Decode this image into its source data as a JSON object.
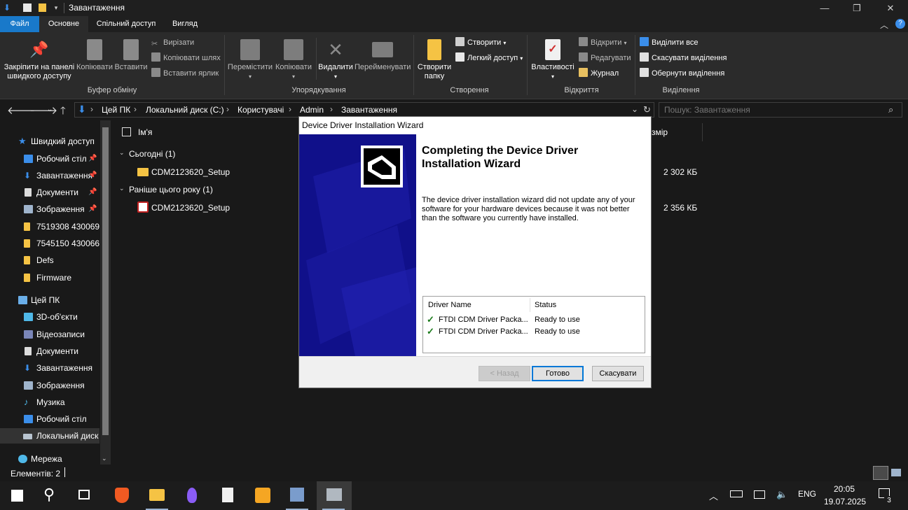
{
  "window": {
    "title": "Завантаження"
  },
  "ribbon_tabs": [
    "Файл",
    "Основне",
    "Спільний доступ",
    "Вигляд"
  ],
  "ribbon": {
    "clipboard": {
      "pin_label_1": "Закріпити на панелі",
      "pin_label_2": "швидкого доступу",
      "copy": "Копіювати",
      "paste": "Вставити",
      "cut": "Вирізати",
      "copy_path": "Копіювати шлях",
      "paste_shortcut": "Вставити ярлик",
      "group_label": "Буфер обміну"
    },
    "organize": {
      "move_to": "Перемістити",
      "copy_to": "Копіювати",
      "delete": "Видалити",
      "rename": "Перейменувати",
      "group_label": "Упорядкування"
    },
    "create": {
      "new_folder_1": "Створити",
      "new_folder_2": "папку",
      "new_item": "Створити",
      "easy_access": "Легкий доступ",
      "group_label": "Створення"
    },
    "open": {
      "properties": "Властивості",
      "open": "Відкрити",
      "edit": "Редагувати",
      "history": "Журнал",
      "group_label": "Відкриття"
    },
    "select": {
      "select_all": "Виділити все",
      "select_none": "Скасувати виділення",
      "invert": "Обернути виділення",
      "group_label": "Виділення"
    }
  },
  "address": {
    "crumbs": [
      "Цей ПК",
      "Локальний диск (C:)",
      "Користувачі",
      "Admin",
      "Завантаження"
    ],
    "search_placeholder": "Пошук: Завантаження"
  },
  "nav_pane": {
    "quick_access": "Швидкий доступ",
    "quick_items": [
      "Робочий стіл",
      "Завантаження",
      "Документи",
      "Зображення",
      "7519308 430069",
      "7545150 430066",
      "Defs",
      "Firmware"
    ],
    "this_pc": "Цей ПК",
    "pc_items": [
      "3D-об'єкти",
      "Відеозаписи",
      "Документи",
      "Завантаження",
      "Зображення",
      "Музика",
      "Робочий стіл",
      "Локальний диск"
    ],
    "network": "Мережа"
  },
  "content": {
    "col_name": "Ім'я",
    "col_size": "змір",
    "groups": [
      {
        "label": "Сьогодні (1)",
        "file": "CDM2123620_Setup",
        "size": "2 302 КБ"
      },
      {
        "label": "Раніше цього року (1)",
        "file": "CDM2123620_Setup",
        "size": "2 356 КБ"
      }
    ]
  },
  "status": {
    "items": "Елементів: 2"
  },
  "taskbar": {
    "lang": "ENG",
    "time": "20:05",
    "date": "19.07.2025",
    "notifications": "3"
  },
  "dialog": {
    "title": "Device Driver Installation Wizard",
    "heading_1": "Completing the Device Driver",
    "heading_2": "Installation Wizard",
    "message": "The device driver installation wizard did not update any of your software for your hardware devices because it was not better than the software you currently have installed.",
    "table": {
      "headers": [
        "Driver Name",
        "Status"
      ],
      "rows": [
        {
          "name": "FTDI CDM Driver Packa...",
          "status": "Ready to use"
        },
        {
          "name": "FTDI CDM Driver Packa...",
          "status": "Ready to use"
        }
      ]
    },
    "buttons": {
      "back": "< Назад",
      "finish": "Готово",
      "cancel": "Скасувати"
    }
  },
  "colors": {
    "accent": "#1979ca",
    "banner": "#10108a",
    "folder": "#f5c344"
  }
}
